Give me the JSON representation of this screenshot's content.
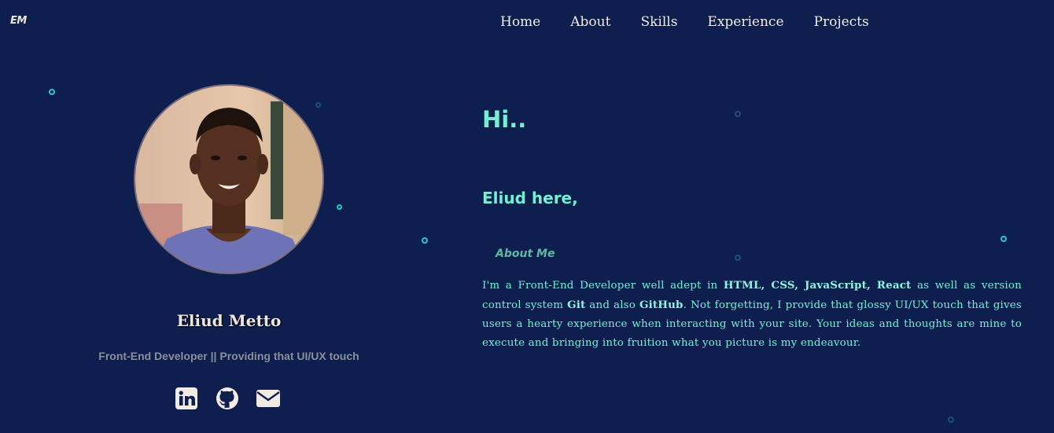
{
  "brand": {
    "logo": "EM"
  },
  "nav": {
    "items": [
      "Home",
      "About",
      "Skills",
      "Experience",
      "Projects"
    ]
  },
  "profile": {
    "name": "Eliud Metto",
    "tagline": "Front-End Developer || Providing that UI/UX touch",
    "avatar_alt": "profile-photo"
  },
  "socials": {
    "icons": [
      "linkedin-icon",
      "github-icon",
      "envelope-icon"
    ]
  },
  "intro": {
    "hi": "Hi..",
    "greeting": "Eliud here,",
    "about_title": "About Me",
    "bio": {
      "p1": "I'm a Front-End Developer well adept in ",
      "s1": "HTML, CSS, JavaScript, React",
      "p2": " as well as version control system ",
      "s2": "Git",
      "p3": " and also ",
      "s3": "GitHub",
      "p4": ". Not forgetting, I provide that glossy UI/UX touch that gives users a hearty experience when interacting with your site. Your ideas and thoughts are mine to execute and bringing into fruition what you picture is my endeavour."
    }
  },
  "colors": {
    "background": "#0e1f4f",
    "accent": "#72f0d2",
    "nav_text": "#f1ebe4",
    "muted": "#8a8f9c",
    "particle": "#24c6d0"
  }
}
